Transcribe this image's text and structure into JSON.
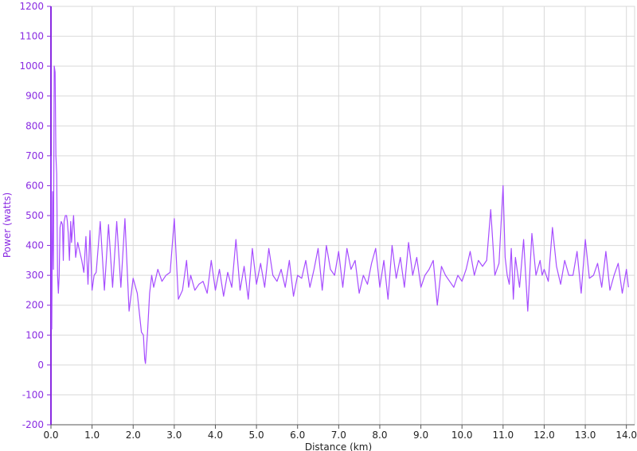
{
  "chart_data": {
    "type": "line",
    "xlabel": "Distance (km)",
    "ylabel": "Power (watts)",
    "xlim": [
      0,
      14.2
    ],
    "ylim": [
      -200,
      1200
    ],
    "x_ticks": [
      0.0,
      1.0,
      2.0,
      3.0,
      4.0,
      5.0,
      6.0,
      7.0,
      8.0,
      9.0,
      10.0,
      11.0,
      12.0,
      13.0,
      14.0
    ],
    "x_tick_labels": [
      "0.0",
      "1.0",
      "2.0",
      "3.0",
      "4.0",
      "5.0",
      "6.0",
      "7.0",
      "8.0",
      "9.0",
      "10.0",
      "11.0",
      "12.0",
      "13.0",
      "14.0"
    ],
    "y_ticks": [
      -200,
      -100,
      0,
      100,
      200,
      300,
      400,
      500,
      600,
      700,
      800,
      900,
      1000,
      1100,
      1200
    ],
    "y_tick_labels": [
      "-200",
      "-100",
      "0",
      "100",
      "200",
      "300",
      "400",
      "500",
      "600",
      "700",
      "800",
      "900",
      "1000",
      "1100",
      "1200"
    ],
    "grid": true,
    "colors": {
      "line": "#a64dff",
      "axis": "#8a2be2",
      "grid": "#d9d9d9"
    },
    "series": [
      {
        "x": [
          0.0,
          0.02,
          0.04,
          0.06,
          0.08,
          0.1,
          0.12,
          0.14,
          0.16,
          0.18,
          0.2,
          0.22,
          0.25,
          0.28,
          0.3,
          0.32,
          0.35,
          0.38,
          0.4,
          0.42,
          0.45,
          0.48,
          0.5,
          0.55,
          0.6,
          0.65,
          0.7,
          0.75,
          0.8,
          0.85,
          0.9,
          0.95,
          1.0,
          1.05,
          1.1,
          1.2,
          1.3,
          1.4,
          1.5,
          1.6,
          1.7,
          1.8,
          1.9,
          2.0,
          2.1,
          2.2,
          2.25,
          2.28,
          2.3,
          2.35,
          2.4,
          2.45,
          2.5,
          2.6,
          2.7,
          2.8,
          2.9,
          3.0,
          3.1,
          3.2,
          3.3,
          3.35,
          3.4,
          3.5,
          3.6,
          3.7,
          3.8,
          3.9,
          4.0,
          4.1,
          4.2,
          4.3,
          4.4,
          4.5,
          4.6,
          4.7,
          4.8,
          4.9,
          5.0,
          5.1,
          5.2,
          5.3,
          5.4,
          5.5,
          5.6,
          5.7,
          5.8,
          5.9,
          6.0,
          6.1,
          6.2,
          6.3,
          6.4,
          6.5,
          6.6,
          6.7,
          6.8,
          6.9,
          7.0,
          7.1,
          7.2,
          7.3,
          7.4,
          7.5,
          7.6,
          7.7,
          7.8,
          7.9,
          8.0,
          8.1,
          8.2,
          8.3,
          8.4,
          8.5,
          8.6,
          8.7,
          8.8,
          8.9,
          9.0,
          9.1,
          9.2,
          9.3,
          9.4,
          9.5,
          9.6,
          9.7,
          9.8,
          9.9,
          10.0,
          10.1,
          10.2,
          10.3,
          10.4,
          10.5,
          10.6,
          10.7,
          10.8,
          10.9,
          11.0,
          11.05,
          11.1,
          11.15,
          11.2,
          11.25,
          11.3,
          11.4,
          11.5,
          11.6,
          11.7,
          11.8,
          11.9,
          11.95,
          12.0,
          12.1,
          12.2,
          12.3,
          12.4,
          12.5,
          12.6,
          12.7,
          12.8,
          12.9,
          13.0,
          13.1,
          13.2,
          13.3,
          13.4,
          13.5,
          13.6,
          13.7,
          13.8,
          13.9,
          14.0,
          14.05
        ],
        "y": [
          700,
          120,
          580,
          320,
          1000,
          980,
          700,
          640,
          300,
          240,
          300,
          460,
          480,
          470,
          350,
          480,
          500,
          500,
          480,
          440,
          350,
          480,
          410,
          500,
          360,
          410,
          380,
          350,
          310,
          430,
          270,
          450,
          250,
          300,
          310,
          480,
          250,
          470,
          260,
          480,
          260,
          490,
          180,
          290,
          240,
          110,
          100,
          20,
          5,
          110,
          240,
          300,
          260,
          320,
          280,
          300,
          310,
          490,
          220,
          250,
          350,
          260,
          300,
          250,
          270,
          280,
          240,
          350,
          250,
          320,
          230,
          310,
          260,
          420,
          250,
          330,
          220,
          390,
          270,
          340,
          260,
          390,
          300,
          280,
          320,
          260,
          350,
          230,
          300,
          290,
          350,
          260,
          320,
          390,
          250,
          400,
          320,
          300,
          380,
          260,
          390,
          320,
          350,
          240,
          300,
          270,
          340,
          390,
          260,
          350,
          220,
          400,
          290,
          360,
          260,
          410,
          300,
          360,
          260,
          300,
          320,
          350,
          200,
          330,
          300,
          280,
          260,
          300,
          280,
          320,
          380,
          300,
          350,
          330,
          350,
          520,
          300,
          340,
          600,
          360,
          300,
          270,
          390,
          220,
          360,
          260,
          420,
          180,
          440,
          300,
          350,
          300,
          320,
          280,
          460,
          330,
          270,
          350,
          300,
          300,
          380,
          240,
          420,
          290,
          300,
          340,
          260,
          380,
          250,
          300,
          340,
          240,
          320,
          260
        ]
      }
    ]
  }
}
